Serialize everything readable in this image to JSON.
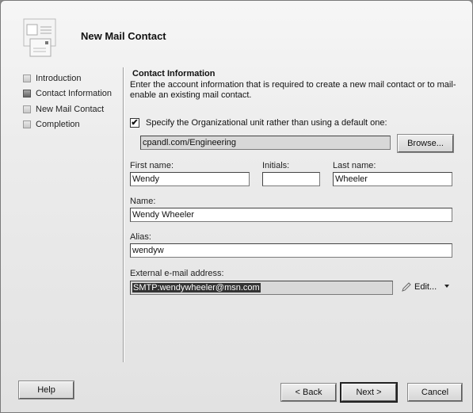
{
  "window": {
    "title": "New Mail Contact"
  },
  "nav": {
    "items": [
      {
        "label": "Introduction",
        "state": "done"
      },
      {
        "label": "Contact Information",
        "state": "active"
      },
      {
        "label": "New Mail Contact",
        "state": "pending"
      },
      {
        "label": "Completion",
        "state": "pending"
      }
    ]
  },
  "content": {
    "section_title": "Contact Information",
    "description": "Enter the account information that is required to create a new mail contact or to mail-enable an existing mail contact.",
    "ou_checkbox": {
      "label": "Specify the Organizational unit rather than using a default one:",
      "checked": true,
      "mark": "✔"
    },
    "ou_value": "cpandl.com/Engineering",
    "browse_label": "Browse...",
    "first_name": {
      "label": "First name:",
      "value": "Wendy"
    },
    "initials": {
      "label": "Initials:",
      "value": ""
    },
    "last_name": {
      "label": "Last name:",
      "value": "Wheeler"
    },
    "name": {
      "label": "Name:",
      "value": "Wendy Wheeler"
    },
    "alias": {
      "label": "Alias:",
      "value": "wendyw"
    },
    "external_email": {
      "label": "External e-mail address:",
      "value": "SMTP:wendywheeler@msn.com"
    },
    "edit_label": "Edit..."
  },
  "footer": {
    "help": "Help",
    "back": "< Back",
    "next": "Next >",
    "cancel": "Cancel"
  }
}
